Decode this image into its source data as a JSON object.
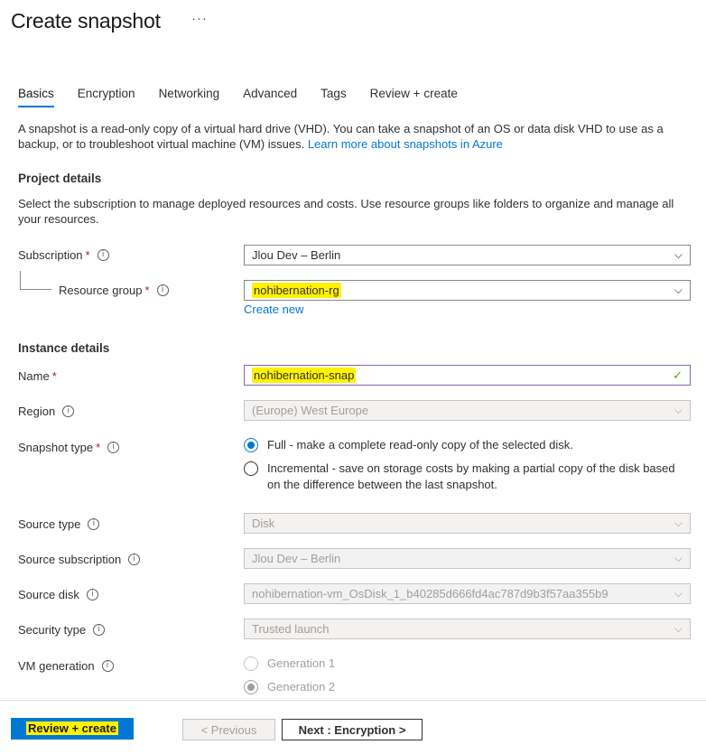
{
  "header": {
    "title": "Create snapshot",
    "more": "···"
  },
  "tabs": [
    {
      "label": "Basics",
      "active": true
    },
    {
      "label": "Encryption"
    },
    {
      "label": "Networking"
    },
    {
      "label": "Advanced"
    },
    {
      "label": "Tags"
    },
    {
      "label": "Review + create"
    }
  ],
  "intro": {
    "text": "A snapshot is a read-only copy of a virtual hard drive (VHD). You can take a snapshot of an OS or data disk VHD to use as a backup, or to troubleshoot virtual machine (VM) issues.",
    "link": "Learn more about snapshots in Azure"
  },
  "project": {
    "heading": "Project details",
    "desc": "Select the subscription to manage deployed resources and costs. Use resource groups like folders to organize and manage all your resources.",
    "subscription_label": "Subscription",
    "subscription_value": "Jlou Dev – Berlin",
    "rg_label": "Resource group",
    "rg_value": "nohibernation-rg",
    "create_new": "Create new"
  },
  "instance": {
    "heading": "Instance details",
    "name_label": "Name",
    "name_value": "nohibernation-snap",
    "region_label": "Region",
    "region_value": "(Europe) West Europe",
    "snapshot_type_label": "Snapshot type",
    "full_option": "Full - make a complete read-only copy of the selected disk.",
    "incremental_option": "Incremental - save on storage costs by making a partial copy of the disk based on the difference between the last snapshot.",
    "source_type_label": "Source type",
    "source_type_value": "Disk",
    "source_sub_label": "Source subscription",
    "source_sub_value": "Jlou Dev – Berlin",
    "source_disk_label": "Source disk",
    "source_disk_value": "nohibernation-vm_OsDisk_1_b40285d666fd4ac787d9b3f57aa355b9",
    "security_label": "Security type",
    "security_value": "Trusted launch",
    "vmgen_label": "VM generation",
    "gen1": "Generation 1",
    "gen2": "Generation 2"
  },
  "footer": {
    "review_create": "Review + create",
    "previous": "< Previous",
    "next": "Next : Encryption >"
  },
  "icons": {
    "required": "*",
    "info": "i",
    "chevron": "⌵",
    "check": "✓"
  },
  "colors": {
    "accent": "#0078d4",
    "highlight": "#fff200",
    "required": "#a4262c",
    "valid": "#57a300"
  }
}
